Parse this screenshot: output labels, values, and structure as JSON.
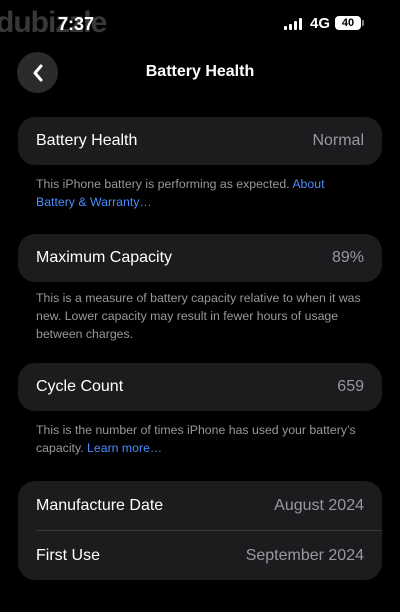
{
  "status_bar": {
    "watermark": "dubizzle",
    "time": "7:37",
    "network": "4G",
    "battery_level": "40"
  },
  "nav": {
    "title": "Battery Health",
    "back_icon": "chevron-left-icon"
  },
  "battery_health": {
    "label": "Battery Health",
    "value": "Normal",
    "note": "This iPhone battery is performing as expected.",
    "link": "About Battery & Warranty…"
  },
  "maximum_capacity": {
    "label": "Maximum Capacity",
    "value": "89%",
    "note": "This is a measure of battery capacity relative to when it was new. Lower capacity may result in fewer hours of usage between charges."
  },
  "cycle_count": {
    "label": "Cycle Count",
    "value": "659",
    "note": "This is the number of times iPhone has used your battery’s capacity.",
    "link": "Learn more…"
  },
  "dates": {
    "manufacture_label": "Manufacture Date",
    "manufacture_value": "August 2024",
    "first_use_label": "First Use",
    "first_use_value": "September 2024"
  },
  "colors": {
    "background": "#000000",
    "card": "#1c1c1e",
    "secondary_text": "#98989e",
    "link": "#4b8dff"
  }
}
